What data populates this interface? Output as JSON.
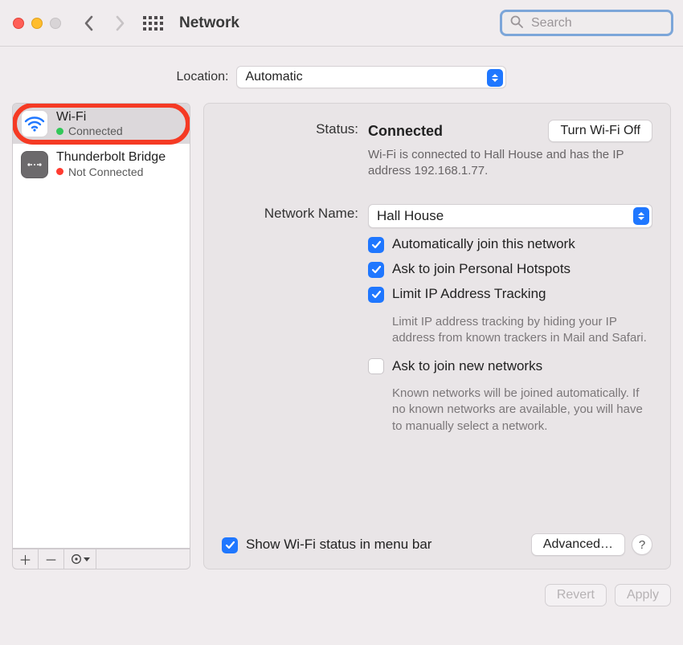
{
  "window": {
    "title": "Network"
  },
  "search": {
    "placeholder": "Search"
  },
  "location": {
    "label": "Location:",
    "selected": "Automatic"
  },
  "sidebar": {
    "items": [
      {
        "title": "Wi-Fi",
        "status": "Connected",
        "dot": "green",
        "selected": true,
        "highlighted": true,
        "icon": "wifi"
      },
      {
        "title": "Thunderbolt Bridge",
        "status": "Not Connected",
        "dot": "red",
        "selected": false,
        "highlighted": false,
        "icon": "thunderbolt"
      }
    ]
  },
  "panel": {
    "status_label": "Status:",
    "status_value": "Connected",
    "turn_off_label": "Turn Wi-Fi Off",
    "status_text": "Wi-Fi is connected to Hall House and has the IP address 192.168.1.77.",
    "network_name_label": "Network Name:",
    "network_name_value": "Hall House",
    "opt_auto_join": "Automatically join this network",
    "opt_hotspots": "Ask to join Personal Hotspots",
    "opt_limit_ip": "Limit IP Address Tracking",
    "opt_limit_ip_desc": "Limit IP address tracking by hiding your IP address from known trackers in Mail and Safari.",
    "opt_ask_new": "Ask to join new networks",
    "opt_ask_new_desc": "Known networks will be joined automatically. If no known networks are available, you will have to manually select a network.",
    "show_status_menubar": "Show Wi-Fi status in menu bar",
    "advanced_label": "Advanced…",
    "help_label": "?"
  },
  "footer": {
    "revert": "Revert",
    "apply": "Apply"
  }
}
